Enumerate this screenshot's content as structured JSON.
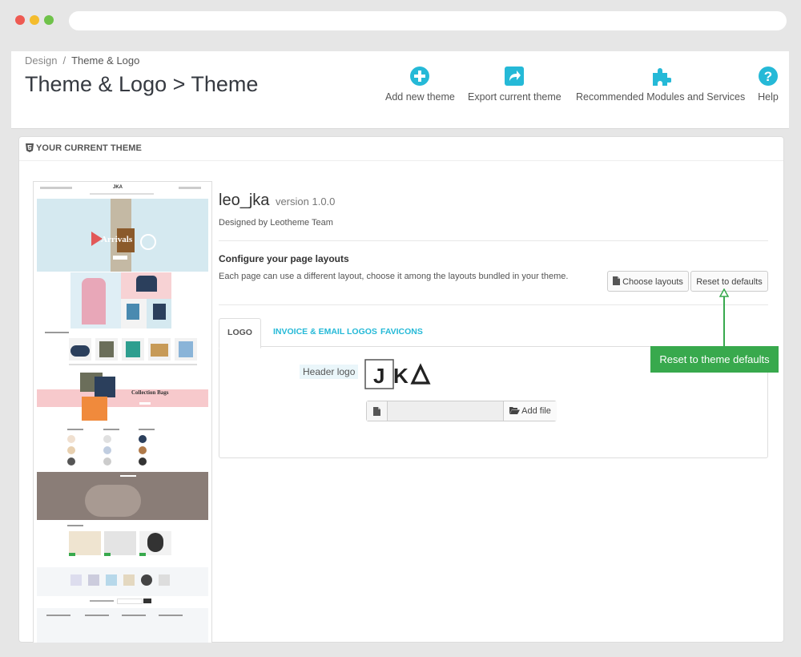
{
  "breadcrumb": {
    "parent": "Design",
    "separator": "/",
    "current": "Theme & Logo"
  },
  "page": {
    "title": "Theme & Logo > Theme"
  },
  "toolbar": [
    {
      "label": "Add new theme",
      "icon": "add-circle-icon"
    },
    {
      "label": "Export current theme",
      "icon": "share-icon"
    },
    {
      "label": "Recommended Modules and Services",
      "icon": "puzzle-icon"
    },
    {
      "label": "Help",
      "icon": "help-icon"
    }
  ],
  "panel": {
    "heading": "YOUR CURRENT THEME",
    "heading_icon": "html5-icon"
  },
  "theme": {
    "name": "leo_jka",
    "version": "version 1.0.0",
    "designed_by": "Designed by Leotheme Team",
    "preview_banner_text": "Arrivals",
    "preview_collection_text": "Collection Bags"
  },
  "layouts": {
    "title": "Configure your page layouts",
    "description": "Each page can use a different layout, choose it among the layouts bundled in your theme.",
    "choose_label": "Choose layouts",
    "reset_label": "Reset to defaults"
  },
  "tabs": [
    {
      "label": "LOGO",
      "active": true
    },
    {
      "label": "INVOICE & EMAIL LOGOS",
      "active": false
    },
    {
      "label": "FAVICONS",
      "active": false
    }
  ],
  "logo": {
    "field_label": "Header logo",
    "logo_text": "JKA",
    "add_file_label": "Add file",
    "file_value": ""
  },
  "annotation": {
    "tooltip": "Reset to theme defaults"
  },
  "colors": {
    "accent": "#25b9d7",
    "tooltip": "#38a94d",
    "title": "#363a41"
  }
}
